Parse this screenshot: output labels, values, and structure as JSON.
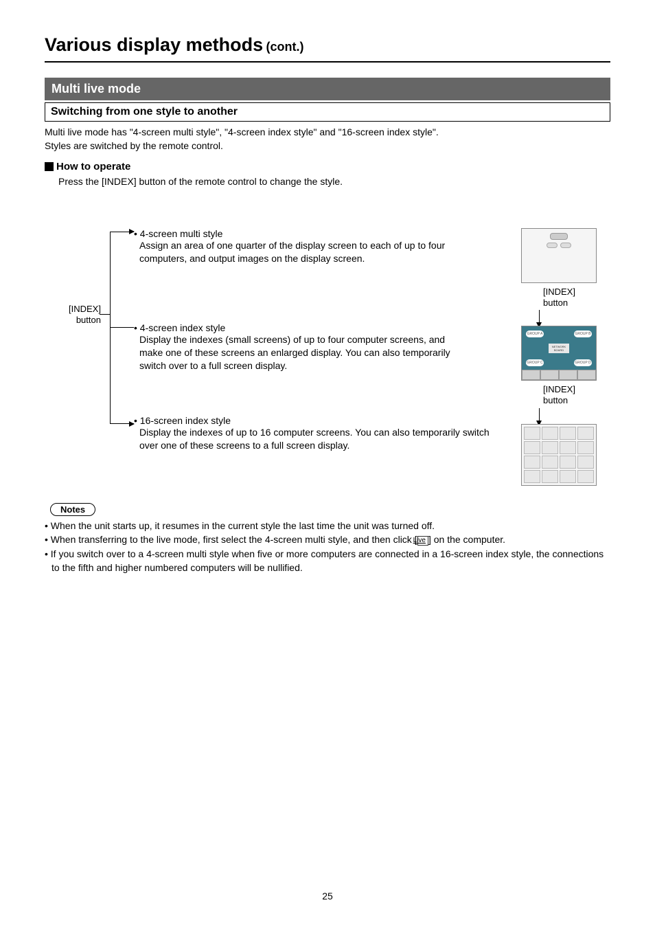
{
  "page": {
    "title_main": "Various display methods",
    "title_cont": "(cont.)",
    "section_title": "Multi live mode",
    "subsection_title": "Switching from one style to another",
    "intro_line1": "Multi live mode has \"4-screen multi style\", \"4-screen index style\" and \"16-screen index style\".",
    "intro_line2": "Styles are switched by the remote control.",
    "how_to_heading": "How to operate",
    "how_to_text": "Press the [INDEX] button of the remote control to change the style.",
    "index_button_left": "[INDEX]\nbutton",
    "styles": [
      {
        "title": "• 4-screen multi style",
        "desc": "Assign an area of one quarter of the display screen to each of up to four computers, and output images on the display screen."
      },
      {
        "title": "• 4-screen index style",
        "desc": "Display the indexes (small screens) of up to four computer screens, and make one of these screens an enlarged display. You can also temporarily switch over to a full screen display."
      },
      {
        "title": "• 16-screen index style",
        "desc": "Display the indexes of up to 16 computer screens. You can also temporarily switch over one of these screens to a full screen display."
      }
    ],
    "index_btn_label_1": "[INDEX]\nbutton",
    "index_btn_label_2": "[INDEX]\nbutton",
    "groups": [
      "GROUP A",
      "GROUP B",
      "GROUP C",
      "GROUP D"
    ],
    "network_center": "NETWORK BOARD",
    "notes_heading": "Notes",
    "live_tag": "Live",
    "notes": [
      "When the unit starts up, it resumes in the current style the last time the unit was turned off.",
      "When transferring to the live mode, first select the 4-screen multi style, and then click [",
      "] on the computer.",
      "If you switch over to a 4-screen multi style when five or more computers are connected in a 16-screen index style, the connections to the fifth and higher numbered computers will be nullified."
    ],
    "page_number": "25"
  }
}
